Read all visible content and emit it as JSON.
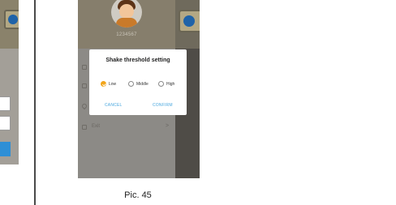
{
  "profile": {
    "user_id": "1234567"
  },
  "dialog": {
    "title": "Shake threshold setting",
    "options": [
      {
        "label": "Low",
        "selected": true
      },
      {
        "label": "Middle",
        "selected": false
      },
      {
        "label": "High",
        "selected": false
      }
    ],
    "cancel": "CANCEL",
    "confirm": "CONFIRM"
  },
  "menu": {
    "exit_label": "Exit",
    "exit_chevron": ">"
  },
  "caption": "Pic. 45",
  "colors": {
    "accent": "#f2a51a",
    "link": "#4aa7df",
    "overlay": "#5a5752"
  }
}
